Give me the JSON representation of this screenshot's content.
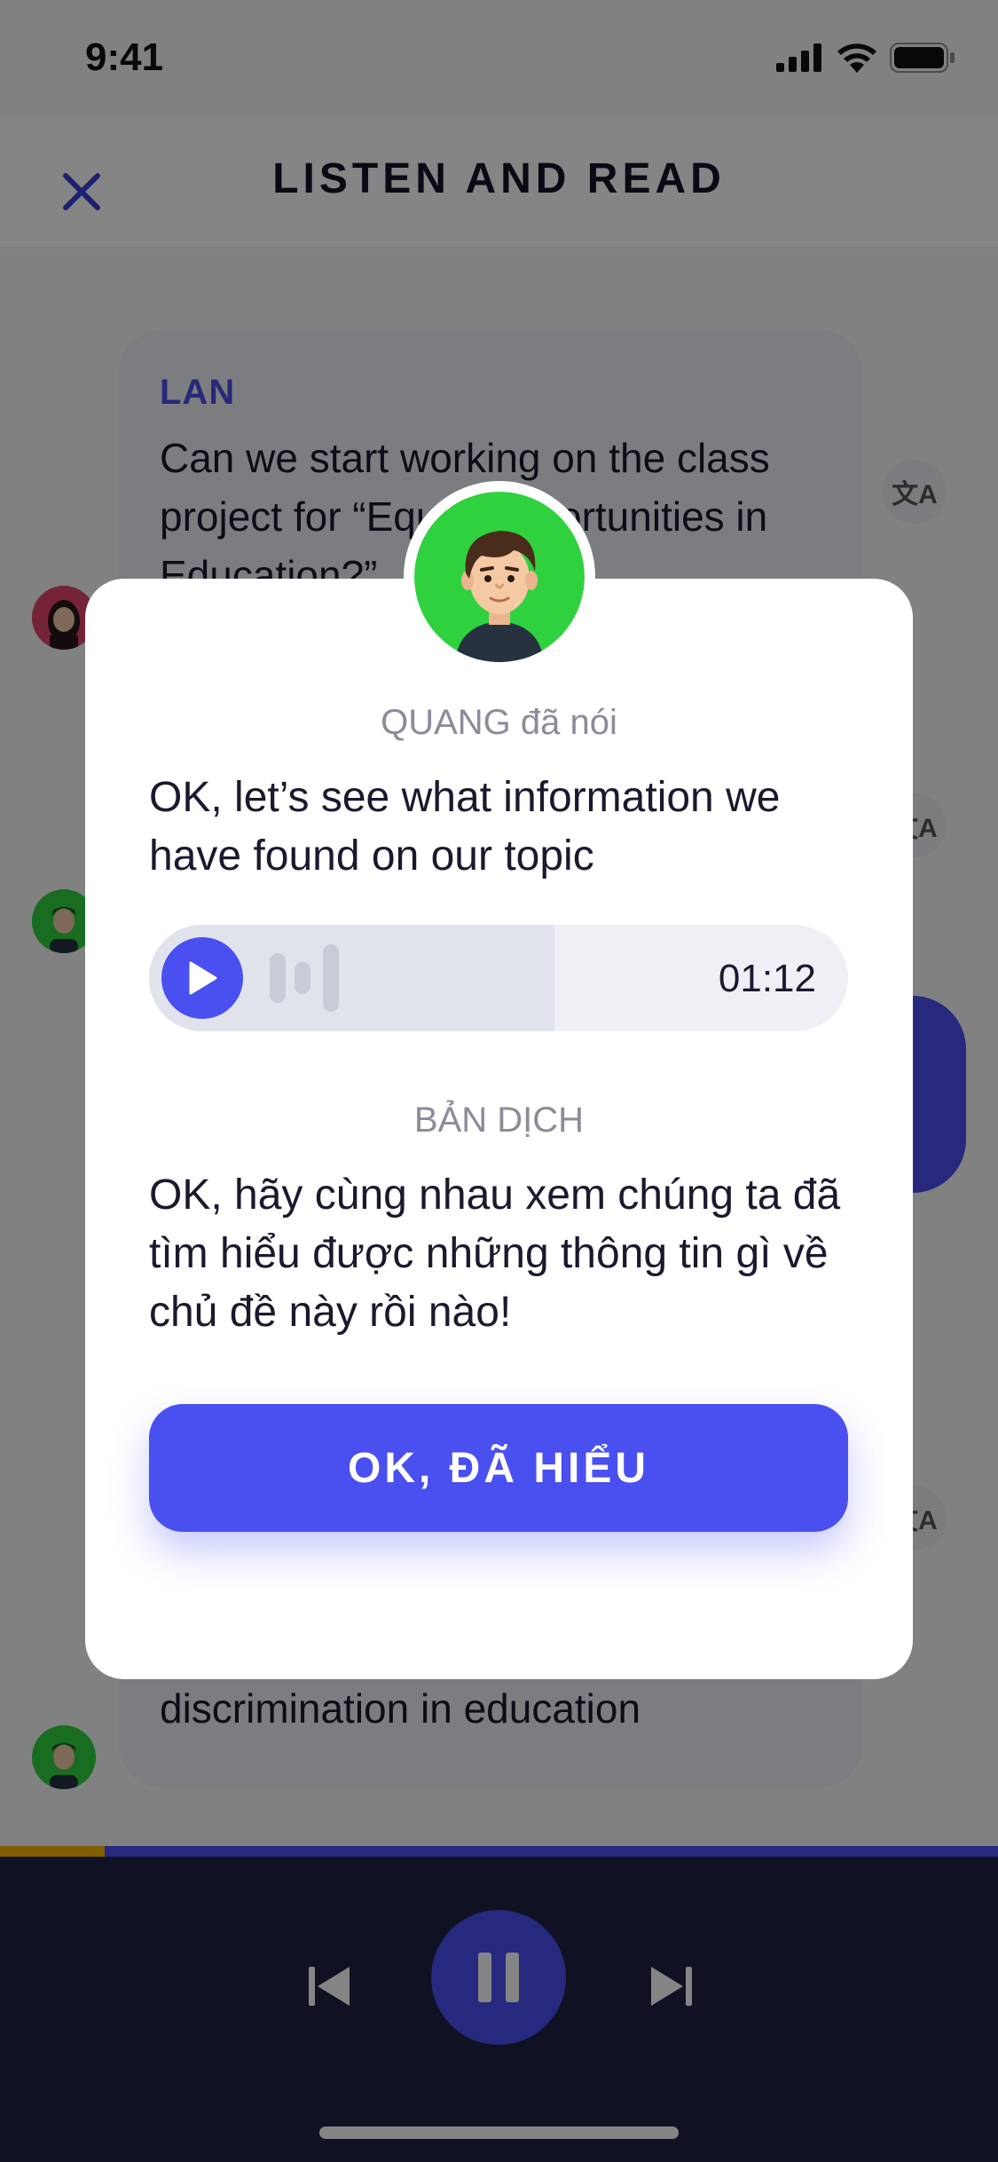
{
  "status_bar": {
    "time": "9:41"
  },
  "nav": {
    "title": "LISTEN AND READ"
  },
  "chat": {
    "message_top": {
      "speaker": "LAN",
      "text": "Can we start working on the class project for “Equal Opportunities in Education?”"
    },
    "message_bottom_partial": "discrimination in education",
    "translate_glyph": "文A"
  },
  "modal": {
    "speaker_label": "QUANG đã nói",
    "quote": "OK, let’s see what information we have found on our topic",
    "audio": {
      "duration": "01:12",
      "played_fraction": 0.58
    },
    "translation_label": "BẢN DỊCH",
    "translation": "OK, hãy cùng nhau xem chúng ta đã tìm hiểu được những thông tin gì về chủ đề này rồi nào!",
    "ok_button": "OK, ĐÃ HIỂU"
  },
  "player": {
    "progress_fraction": 0.105
  },
  "colors": {
    "accent": "#4a4ff0",
    "avatar_quang_bg": "#2fd13f",
    "avatar_lan_bg": "#e0456a",
    "player_bg": "#1f2243",
    "progress": "#f5b400"
  }
}
